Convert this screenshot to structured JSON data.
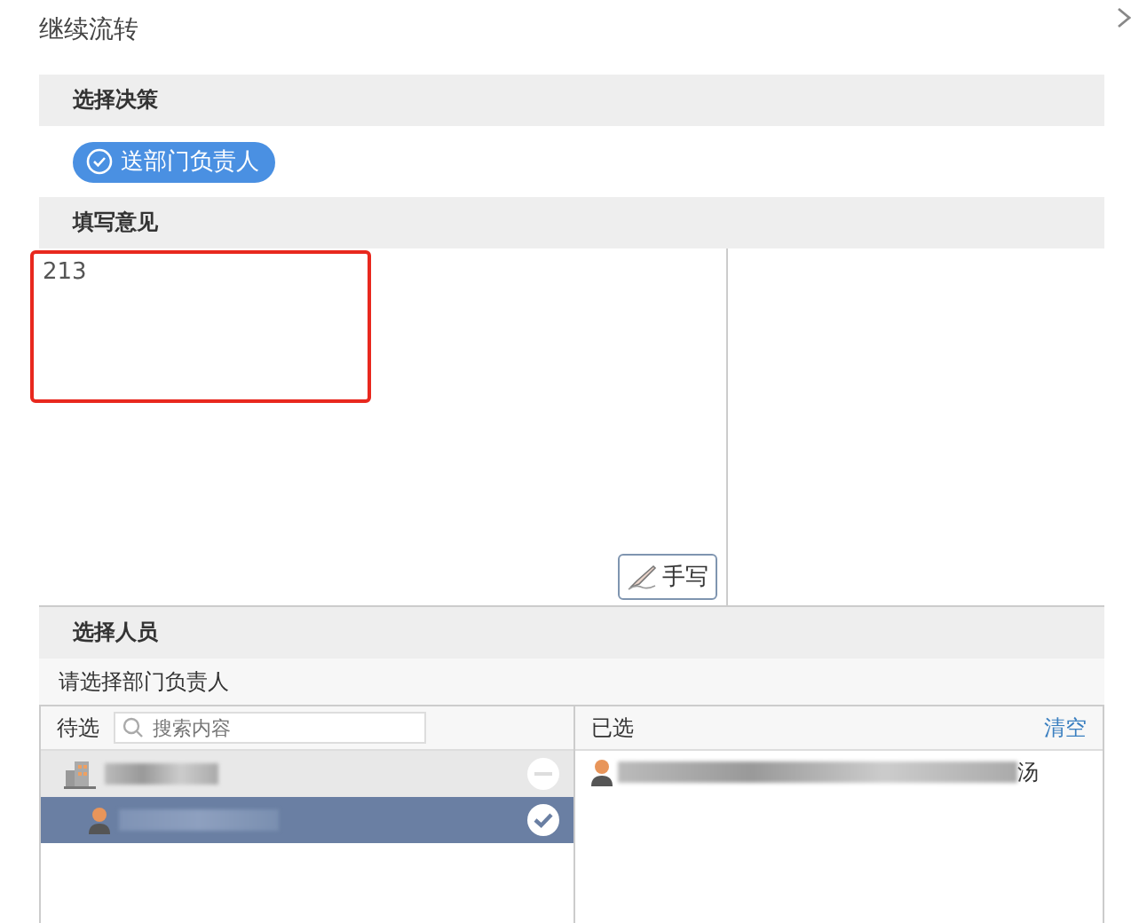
{
  "window": {
    "title": "继续流转"
  },
  "decision": {
    "header": "选择决策",
    "options": [
      {
        "label": "送部门负责人",
        "selected": true
      }
    ]
  },
  "opinion": {
    "header": "填写意见",
    "value": "213",
    "highlighted": true,
    "handwrite_button": "手写"
  },
  "people": {
    "header": "选择人员",
    "hint": "请选择部门负责人",
    "candidates": {
      "label": "待选",
      "search": {
        "placeholder": "搜索内容"
      },
      "rows": [
        {
          "kind": "group",
          "selected": false
        },
        {
          "kind": "person",
          "selected": true
        }
      ]
    },
    "chosen": {
      "label": "已选",
      "clear": "清空",
      "rows": [
        {
          "kind": "person",
          "visible_text": "汤"
        }
      ]
    }
  }
}
